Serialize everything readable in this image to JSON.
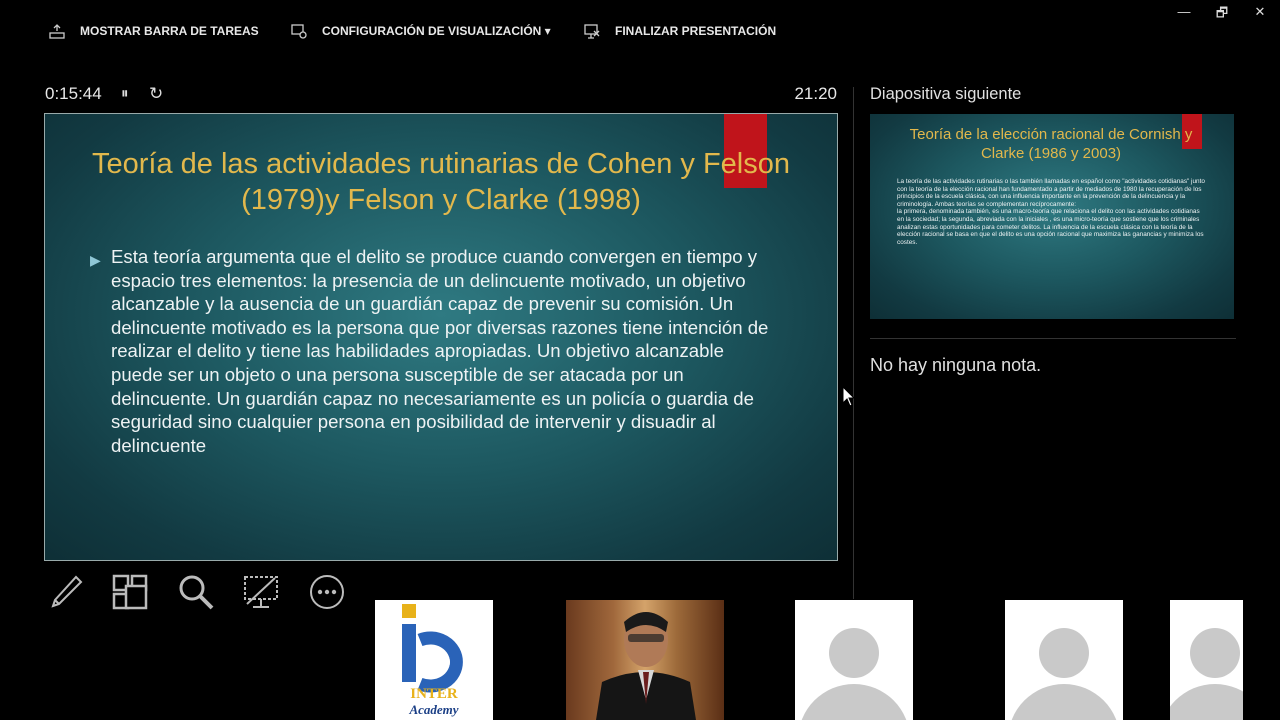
{
  "toolbar": {
    "taskbar_label": "MOSTRAR BARRA DE TAREAS",
    "display_settings_label": "CONFIGURACIÓN DE VISUALIZACIÓN ▾",
    "end_show_label": "FINALIZAR PRESENTACIÓN"
  },
  "window_controls": {
    "minimize": "—",
    "restore": "🗗",
    "close": "✕"
  },
  "presenter": {
    "elapsed": "0:15:44",
    "clock": "21:20",
    "pause_icon": "⏸",
    "restart_icon": "↻"
  },
  "current_slide": {
    "title": "Teoría de las actividades rutinarias de Cohen y Felson (1979)y Felson y Clarke (1998)",
    "bullet_marker": "▶",
    "body": "Esta teoría argumenta que el delito se produce cuando convergen en tiempo y espacio tres elementos: la presencia de un delincuente motivado, un objetivo alcanzable y la ausencia de un guardián capaz de prevenir su comisión. Un delincuente motivado es la persona que por diversas razones tiene intención de realizar el delito y tiene las habilidades apropiadas. Un objetivo alcanzable puede ser un objeto o una persona susceptible de ser atacada por un delincuente. Un guardián capaz no necesariamente es un policía o guardia de seguridad sino cualquier persona en posibilidad de intervenir y disuadir al delincuente"
  },
  "next_slide": {
    "label": "Diapositiva siguiente",
    "title": "Teoría de la elección racional de Cornish y Clarke (1986 y 2003)",
    "body_p1": "La teoría de las actividades rutinarias o las también llamadas en español como \"actividades cotidianas\" junto con la teoría de la elección racional han fundamentado a partir de mediados de 1980 la recuperación de los principios de la escuela clásica, con una influencia importante en la prevención de la delincuencia y la criminología. Ambas teorías se complementan recíprocamente:",
    "body_p2": "la primera, denominada también, es una macro-teoría que relaciona el delito con las actividades cotidianas en la sociedad; la segunda, abreviada con la iniciales , es una micro-teoría que sostiene que los criminales analizan estas oportunidades para cometer delitos. La influencia de la escuela clásica con la teoría de la elección racional se basa en que el delito es una opción racional que maximiza las ganancias y minimiza los costes."
  },
  "notes": {
    "text": "No hay ninguna nota."
  },
  "tools": {
    "pen": "pen-icon",
    "all_slides": "slides-grid-icon",
    "zoom": "zoom-icon",
    "black_screen": "black-screen-icon",
    "more": "more-options-icon"
  },
  "participants": {
    "logo_text_top": "INTER",
    "logo_text_bottom": "Academy"
  },
  "colors": {
    "slide_title": "#e2b84c",
    "slide_accent": "#c0141b",
    "slide_bg": "#1d5860"
  }
}
